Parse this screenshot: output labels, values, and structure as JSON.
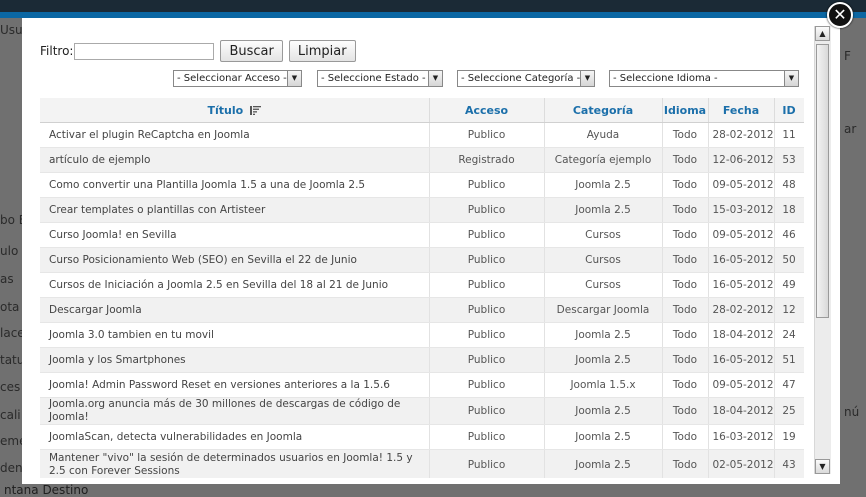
{
  "background": {
    "side_fragments": [
      "Usu",
      "bo E",
      "ulo",
      "as",
      "ota",
      "lace",
      "tatu",
      "ces",
      "cali",
      "eme",
      "den"
    ],
    "right_fragments": [
      "F",
      "ar",
      "nú"
    ],
    "bottom_fragment": "ntana Destino"
  },
  "modal": {
    "close_label": "✕",
    "filter": {
      "label": "Filtro:",
      "value": "",
      "search_button": "Buscar",
      "clear_button": "Limpiar"
    },
    "selects": {
      "access": "- Seleccionar Acceso -",
      "state": "- Seleccione Estado -",
      "category": "- Seleccione Categoría -",
      "language": "- Seleccione Idioma -"
    },
    "table": {
      "headers": {
        "title": "Título",
        "access": "Acceso",
        "category": "Categoría",
        "language": "Idioma",
        "date": "Fecha",
        "id": "ID"
      },
      "rows": [
        {
          "title": "Activar el plugin ReCaptcha en Joomla",
          "access": "Publico",
          "category": "Ayuda",
          "language": "Todo",
          "date": "28-02-2012",
          "id": "11"
        },
        {
          "title": "artículo de ejemplo",
          "access": "Registrado",
          "category": "Categoría ejemplo",
          "language": "Todo",
          "date": "12-06-2012",
          "id": "53"
        },
        {
          "title": "Como convertir una Plantilla Joomla 1.5 a una de Joomla 2.5",
          "access": "Publico",
          "category": "Joomla 2.5",
          "language": "Todo",
          "date": "09-05-2012",
          "id": "48"
        },
        {
          "title": "Crear templates o plantillas con Artisteer",
          "access": "Publico",
          "category": "Joomla 2.5",
          "language": "Todo",
          "date": "15-03-2012",
          "id": "18"
        },
        {
          "title": "Curso Joomla! en Sevilla",
          "access": "Publico",
          "category": "Cursos",
          "language": "Todo",
          "date": "09-05-2012",
          "id": "46"
        },
        {
          "title": "Curso Posicionamiento Web (SEO) en Sevilla el 22 de Junio",
          "access": "Publico",
          "category": "Cursos",
          "language": "Todo",
          "date": "16-05-2012",
          "id": "50"
        },
        {
          "title": "Cursos de Iniciación a Joomla 2.5 en Sevilla del 18 al 21 de Junio",
          "access": "Publico",
          "category": "Cursos",
          "language": "Todo",
          "date": "16-05-2012",
          "id": "49"
        },
        {
          "title": "Descargar Joomla",
          "access": "Publico",
          "category": "Descargar Joomla",
          "language": "Todo",
          "date": "28-02-2012",
          "id": "12"
        },
        {
          "title": "Joomla 3.0 tambien en tu movil",
          "access": "Publico",
          "category": "Joomla 2.5",
          "language": "Todo",
          "date": "18-04-2012",
          "id": "24"
        },
        {
          "title": "Joomla y los Smartphones",
          "access": "Publico",
          "category": "Joomla 2.5",
          "language": "Todo",
          "date": "16-05-2012",
          "id": "51"
        },
        {
          "title": "Joomla! Admin Password Reset en versiones anteriores a la 1.5.6",
          "access": "Publico",
          "category": "Joomla 1.5.x",
          "language": "Todo",
          "date": "09-05-2012",
          "id": "47"
        },
        {
          "title": "Joomla.org anuncia más de 30 millones de descargas de código de Joomla!",
          "access": "Publico",
          "category": "Joomla 2.5",
          "language": "Todo",
          "date": "18-04-2012",
          "id": "25"
        },
        {
          "title": "JoomlaScan, detecta vulnerabilidades en Joomla",
          "access": "Publico",
          "category": "Joomla 2.5",
          "language": "Todo",
          "date": "16-03-2012",
          "id": "19"
        },
        {
          "title": "Mantener \"vivo\" la sesión de determinados usuarios en Joomla! 1.5 y 2.5 con Forever Sessions",
          "access": "Publico",
          "category": "Joomla 2.5",
          "language": "Todo",
          "date": "02-05-2012",
          "id": "43"
        }
      ]
    }
  },
  "icons": {
    "close": "close-icon",
    "sort": "sort-descending-icon",
    "scroll_up": "arrow-up-icon",
    "scroll_down": "arrow-down-icon"
  }
}
